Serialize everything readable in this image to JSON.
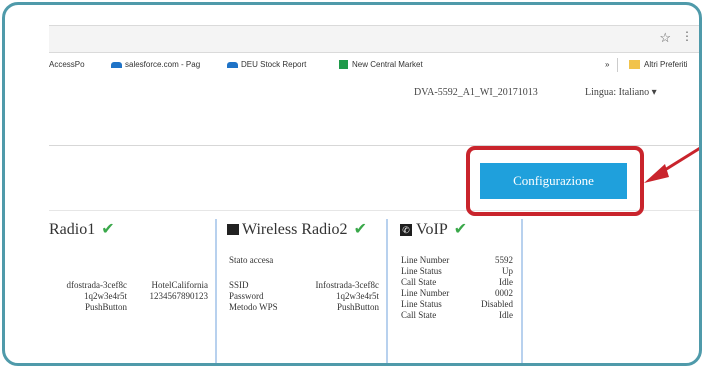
{
  "browser": {
    "star_glyph": "☆",
    "menu_glyph": "⋮",
    "bookmarks": [
      {
        "label": "AccessPo"
      },
      {
        "label": "salesforce.com - Pag"
      },
      {
        "label": "DEU Stock Report"
      },
      {
        "label": "New Central Market"
      }
    ],
    "overflow": "»",
    "other_bookmarks": "Altri Preferiti"
  },
  "header": {
    "firmware": "DVA-5592_A1_WI_20171013",
    "language_label": "Lingua:",
    "language_value": "Italiano",
    "language_caret": "▾"
  },
  "config_button": {
    "label": "Configurazione"
  },
  "colors": {
    "accent": "#1fa0dc",
    "highlight": "#c9242c",
    "frame": "#4f9aaa",
    "check": "#3aa84a"
  },
  "panels": {
    "radio1": {
      "title": "Radio1",
      "col1": [
        "dfostrada-3cef8c",
        "1q2w3e4r5t",
        "PushButton"
      ],
      "col2": [
        "HotelCalifornia",
        "1234567890123"
      ]
    },
    "radio2": {
      "title": "Wireless Radio2",
      "stato": "Stato  accesa",
      "labels": [
        "SSID",
        "Password",
        "Metodo WPS"
      ],
      "values": [
        "Infostrada-3cef8c",
        "1q2w3e4r5t",
        "PushButton"
      ]
    },
    "voip": {
      "title": "VoIP",
      "labels": [
        "Line Number",
        "Line Status",
        "Call State",
        "Line Number",
        "Line Status",
        "Call State"
      ],
      "values": [
        "5592",
        "Up",
        "Idle",
        "0002",
        "Disabled",
        "Idle"
      ]
    }
  }
}
